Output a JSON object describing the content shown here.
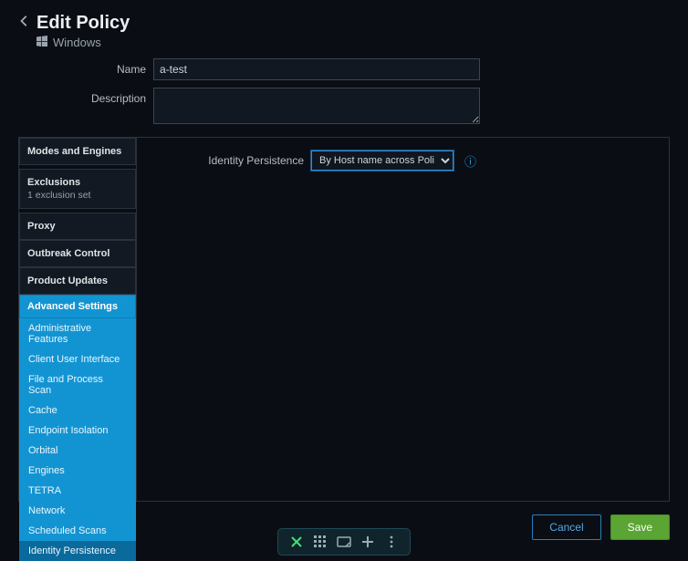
{
  "header": {
    "title": "Edit Policy",
    "platform": "Windows"
  },
  "form": {
    "name_label": "Name",
    "name_value": "a-test",
    "description_label": "Description",
    "description_value": ""
  },
  "sidebar": {
    "blocks": [
      {
        "title": "Modes and Engines",
        "sub": ""
      },
      {
        "title": "Exclusions",
        "sub": "1 exclusion set"
      },
      {
        "title": "Proxy",
        "sub": ""
      }
    ],
    "blocks2": [
      {
        "title": "Outbreak Control",
        "sub": ""
      },
      {
        "title": "Product Updates",
        "sub": ""
      }
    ],
    "advanced_header": "Advanced Settings",
    "advanced_items": [
      "Administrative Features",
      "Client User Interface",
      "File and Process Scan",
      "Cache",
      "Endpoint Isolation",
      "Orbital",
      "Engines",
      "TETRA",
      "Network",
      "Scheduled Scans",
      "Identity Persistence"
    ],
    "advanced_selected_index": 10
  },
  "content": {
    "identity_persistence_label": "Identity Persistence",
    "identity_persistence_value": "By Host name across Policy"
  },
  "footer": {
    "cancel": "Cancel",
    "save": "Save"
  },
  "dock": {
    "icons": [
      "close-icon",
      "grid-icon",
      "screenshot-icon",
      "plus-icon",
      "more-icon"
    ]
  }
}
